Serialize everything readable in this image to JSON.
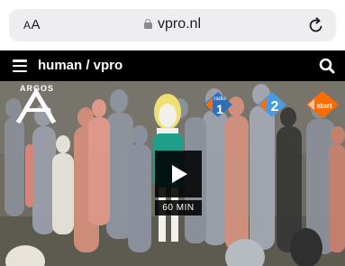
{
  "browser": {
    "text_size_label": "AA",
    "url": "vpro.nl"
  },
  "site": {
    "brand": "human / vpro"
  },
  "video": {
    "duration": "60 MIN",
    "program_logo_text": "ARGOS",
    "channel_logos": [
      {
        "icon": "npo-radio-1-logo",
        "label": "radio",
        "number": "1"
      },
      {
        "icon": "npo-2-logo",
        "number": "2"
      },
      {
        "icon": "npo-start-logo",
        "label": "start"
      }
    ]
  },
  "colors": {
    "url_bar_bg": "#eeeef0",
    "header_bg": "#000000",
    "npo_orange": "#ff6d00",
    "npo_blue": "#2f6eb8"
  }
}
